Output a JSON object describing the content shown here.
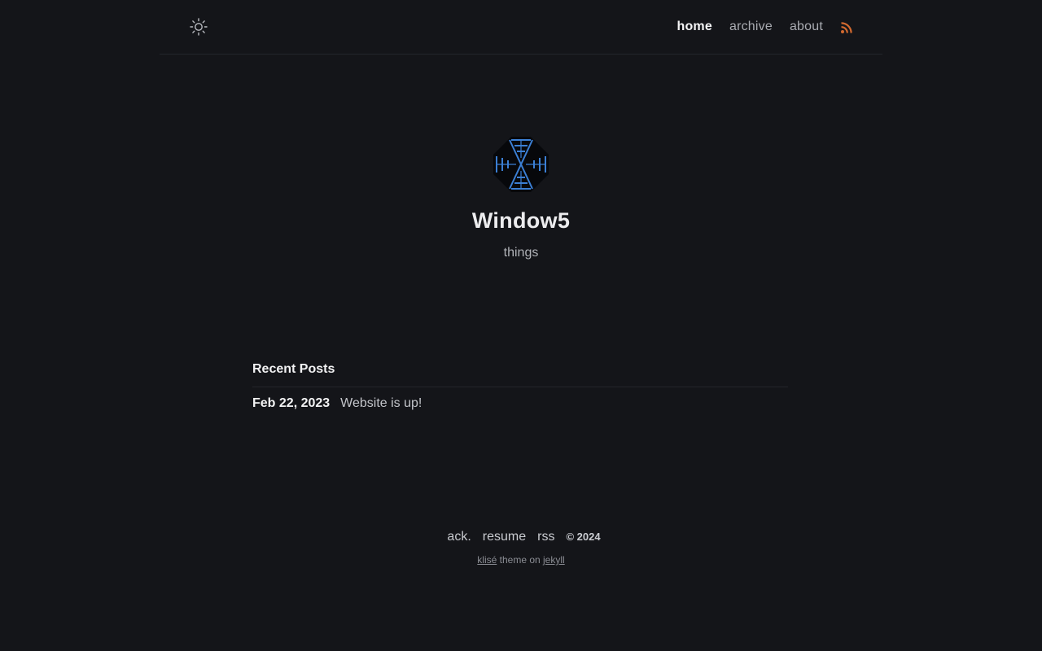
{
  "header": {
    "theme_toggle_icon": "sun-icon",
    "nav": [
      {
        "label": "home",
        "active": true
      },
      {
        "label": "archive",
        "active": false
      },
      {
        "label": "about",
        "active": false
      }
    ],
    "rss_icon": "rss-icon",
    "rss_color": "#d2692f"
  },
  "profile": {
    "avatar_icon": "window-logo-icon",
    "title": "Window5",
    "subtitle": "things"
  },
  "posts": {
    "heading": "Recent Posts",
    "items": [
      {
        "date": "Feb 22, 2023",
        "title": "Website is up!"
      }
    ]
  },
  "footer": {
    "links": [
      "ack.",
      "resume",
      "rss"
    ],
    "copyright": "© 2024",
    "credit_theme_link": "klisé",
    "credit_middle": " theme on ",
    "credit_engine_link": "jekyll"
  },
  "colors": {
    "background": "#141519",
    "accent_blue": "#3b7fd4"
  }
}
